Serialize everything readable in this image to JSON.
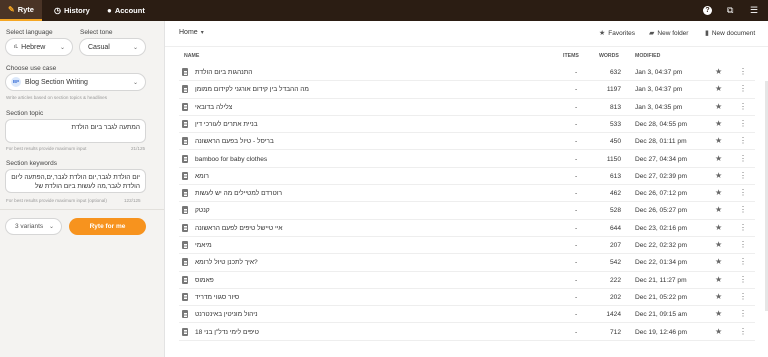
{
  "topbar": {
    "tabs": [
      {
        "label": "Ryte",
        "active": true
      },
      {
        "label": "History",
        "active": false
      },
      {
        "label": "Account",
        "active": false
      }
    ],
    "icons": [
      "help-icon",
      "open-external-icon",
      "menu-icon"
    ]
  },
  "sidebar": {
    "language_label": "Select language",
    "language_value": "Hebrew",
    "language_prefix": "ıL",
    "tone_label": "Select tone",
    "tone_value": "Casual",
    "use_case_label": "Choose use case",
    "use_case_value": "Blog Section Writing",
    "use_case_hint": "Write articles based on section topics & headlines",
    "topic_label": "Section topic",
    "topic_value": "המתעה לגבר ביום הולדת",
    "topic_hint_left": "For best results provide maximum input",
    "topic_hint_right": "21/125",
    "keywords_label": "Section keywords",
    "keywords_value": "יום הולדת לגבר,יום הולדת לגבר,ים,הפתעה ליום הולדת לגבר,מה לעשות ביום הולדת של",
    "keywords_hint_left": "For best results provide maximum input (optional)",
    "keywords_hint_right": "122/125",
    "variants_label": "3 variants",
    "ryte_button": "Ryte for me"
  },
  "main": {
    "breadcrumb": "Home",
    "favorites_label": "Favorites",
    "new_folder_label": "New folder",
    "new_document_label": "New document",
    "columns": {
      "name": "NAME",
      "items": "ITEMS",
      "words": "WORDS",
      "modified": "MODIFIED"
    },
    "rows": [
      {
        "name": "התנהגות ביום הולדת",
        "items": "-",
        "words": "632",
        "modified": "Jan 3, 04:37 pm"
      },
      {
        "name": "מה ההבדל בין קידום אורגני לקידום ממומן",
        "items": "-",
        "words": "1197",
        "modified": "Jan 3, 04:37 pm"
      },
      {
        "name": "צלילה בדובאי",
        "items": "-",
        "words": "813",
        "modified": "Jan 3, 04:35 pm"
      },
      {
        "name": "בניית אתרים לעורכי דין",
        "items": "-",
        "words": "533",
        "modified": "Dec 28, 04:55 pm"
      },
      {
        "name": "בריסל - טיול בפעם הראשונה",
        "items": "-",
        "words": "450",
        "modified": "Dec 28, 01:11 pm"
      },
      {
        "name": "bamboo for baby clothes",
        "items": "-",
        "words": "1150",
        "modified": "Dec 27, 04:34 pm"
      },
      {
        "name": "רומא",
        "items": "-",
        "words": "613",
        "modified": "Dec 27, 02:39 pm"
      },
      {
        "name": "רוטרדם למטיילים מה יש לעשות",
        "items": "-",
        "words": "462",
        "modified": "Dec 26, 07:12 pm"
      },
      {
        "name": "קנטק",
        "items": "-",
        "words": "528",
        "modified": "Dec 26, 05:27 pm"
      },
      {
        "name": "איי טיישל טיפים לפעם הראשונה",
        "items": "-",
        "words": "644",
        "modified": "Dec 23, 02:16 pm"
      },
      {
        "name": "מיאמי",
        "items": "-",
        "words": "207",
        "modified": "Dec 22, 02:32 pm"
      },
      {
        "name": "איך לתכנן טיול לרומא?",
        "items": "-",
        "words": "542",
        "modified": "Dec 22, 01:34 pm"
      },
      {
        "name": "פאמוס",
        "items": "-",
        "words": "222",
        "modified": "Dec 21, 11:27 pm"
      },
      {
        "name": "סיור סגווי מדריד",
        "items": "-",
        "words": "202",
        "modified": "Dec 21, 05:22 pm"
      },
      {
        "name": "ניהול מוניטין באינטרנט",
        "items": "-",
        "words": "1424",
        "modified": "Dec 21, 09:15 am"
      },
      {
        "name": "טיפים לימי נדל\"ן בני 18",
        "items": "-",
        "words": "712",
        "modified": "Dec 19, 12:46 pm"
      }
    ]
  }
}
